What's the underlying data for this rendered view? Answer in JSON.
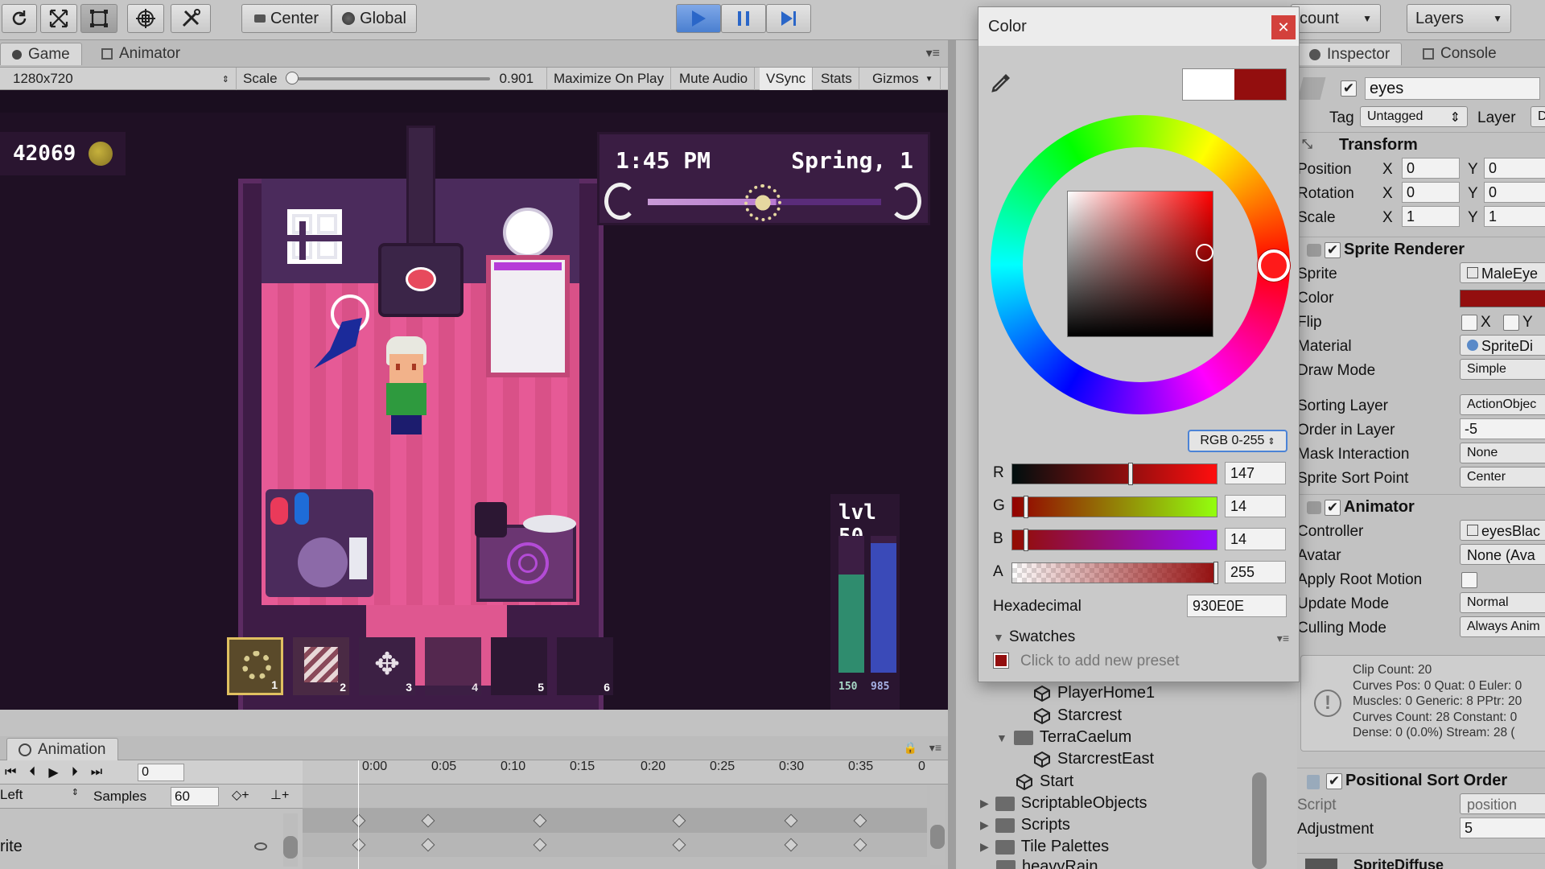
{
  "toolbar": {
    "pivot_label": "Center",
    "space_label": "Global",
    "account_label": "count",
    "layers_label": "Layers"
  },
  "game_panel": {
    "tabs": [
      "Game",
      "Animator"
    ],
    "resolution": "1280x720",
    "scale_label": "Scale",
    "scale_value": "0.901",
    "options": [
      "Maximize On Play",
      "Mute Audio",
      "VSync",
      "Stats",
      "Gizmos"
    ]
  },
  "game_hud": {
    "coins": "42069",
    "time": "1:45 PM",
    "season": "Spring, 1",
    "level": "lvl 50",
    "health_value": "150",
    "mana_value": "985",
    "health_fill": 0.72,
    "mana_fill": 0.95,
    "hotbar_slots": [
      "1",
      "2",
      "3",
      "4",
      "5",
      "6"
    ]
  },
  "color_picker": {
    "title": "Color",
    "mode": "RGB 0-255",
    "channels": [
      {
        "label": "R",
        "value": "147",
        "fraction": 0.576
      },
      {
        "label": "G",
        "value": "14",
        "fraction": 0.055
      },
      {
        "label": "B",
        "value": "14",
        "fraction": 0.055
      },
      {
        "label": "A",
        "value": "255",
        "fraction": 1.0
      }
    ],
    "hex_label": "Hexadecimal",
    "hex_value": "930E0E",
    "swatches_label": "Swatches",
    "add_preset": "Click to add new preset",
    "current_color": "#930E0E"
  },
  "inspector": {
    "tabs": [
      "Inspector",
      "Console"
    ],
    "object_name": "eyes",
    "tag_label": "Tag",
    "tag_value": "Untagged",
    "layer_label": "Layer",
    "layer_value": "D",
    "transform": {
      "title": "Transform",
      "rows": [
        {
          "label": "Position",
          "x": "0",
          "y": "0"
        },
        {
          "label": "Rotation",
          "x": "0",
          "y": "0"
        },
        {
          "label": "Scale",
          "x": "1",
          "y": "1"
        }
      ]
    },
    "sprite_renderer": {
      "title": "Sprite Renderer",
      "sprite_label": "Sprite",
      "sprite_value": "MaleEye",
      "color_label": "Color",
      "flip_label": "Flip",
      "flip_x": "X",
      "flip_y": "Y",
      "material_label": "Material",
      "material_value": "SpriteDi",
      "draw_mode_label": "Draw Mode",
      "draw_mode_value": "Simple",
      "sorting_layer_label": "Sorting Layer",
      "sorting_layer_value": "ActionObjec",
      "order_label": "Order in Layer",
      "order_value": "-5",
      "mask_label": "Mask Interaction",
      "mask_value": "None",
      "sort_point_label": "Sprite Sort Point",
      "sort_point_value": "Center"
    },
    "animator": {
      "title": "Animator",
      "controller_label": "Controller",
      "controller_value": "eyesBlac",
      "avatar_label": "Avatar",
      "avatar_value": "None (Ava",
      "root_motion_label": "Apply Root Motion",
      "update_label": "Update Mode",
      "update_value": "Normal",
      "culling_label": "Culling Mode",
      "culling_value": "Always Anim",
      "info": [
        "Clip Count: 20",
        "Curves Pos: 0 Quat: 0 Euler: 0",
        "Muscles: 0 Generic: 8 PPtr: 20",
        "Curves Count: 28 Constant: 0",
        "Dense: 0 (0.0%) Stream: 28 ("
      ]
    },
    "positional_sort": {
      "title": "Positional Sort Order",
      "script_label": "Script",
      "script_value": "position",
      "adjustment_label": "Adjustment",
      "adjustment_value": "5"
    },
    "material_footer": "SpriteDiffuse"
  },
  "hierarchy": {
    "items": [
      "PlayerHome1",
      "Starcrest",
      "TerraCaelum",
      "StarcrestEast",
      "Start",
      "ScriptableObjects",
      "Scripts",
      "Tile Palettes",
      "heavyRain"
    ]
  },
  "animation_panel": {
    "title": "Animation",
    "frame": "0",
    "clip_label": "Left",
    "samples_label": "Samples",
    "samples_value": "60",
    "property_label": "rite",
    "ruler": [
      "0:00",
      "0:05",
      "0:10",
      "0:15",
      "0:20",
      "0:25",
      "0:30",
      "0:35",
      "0"
    ]
  }
}
